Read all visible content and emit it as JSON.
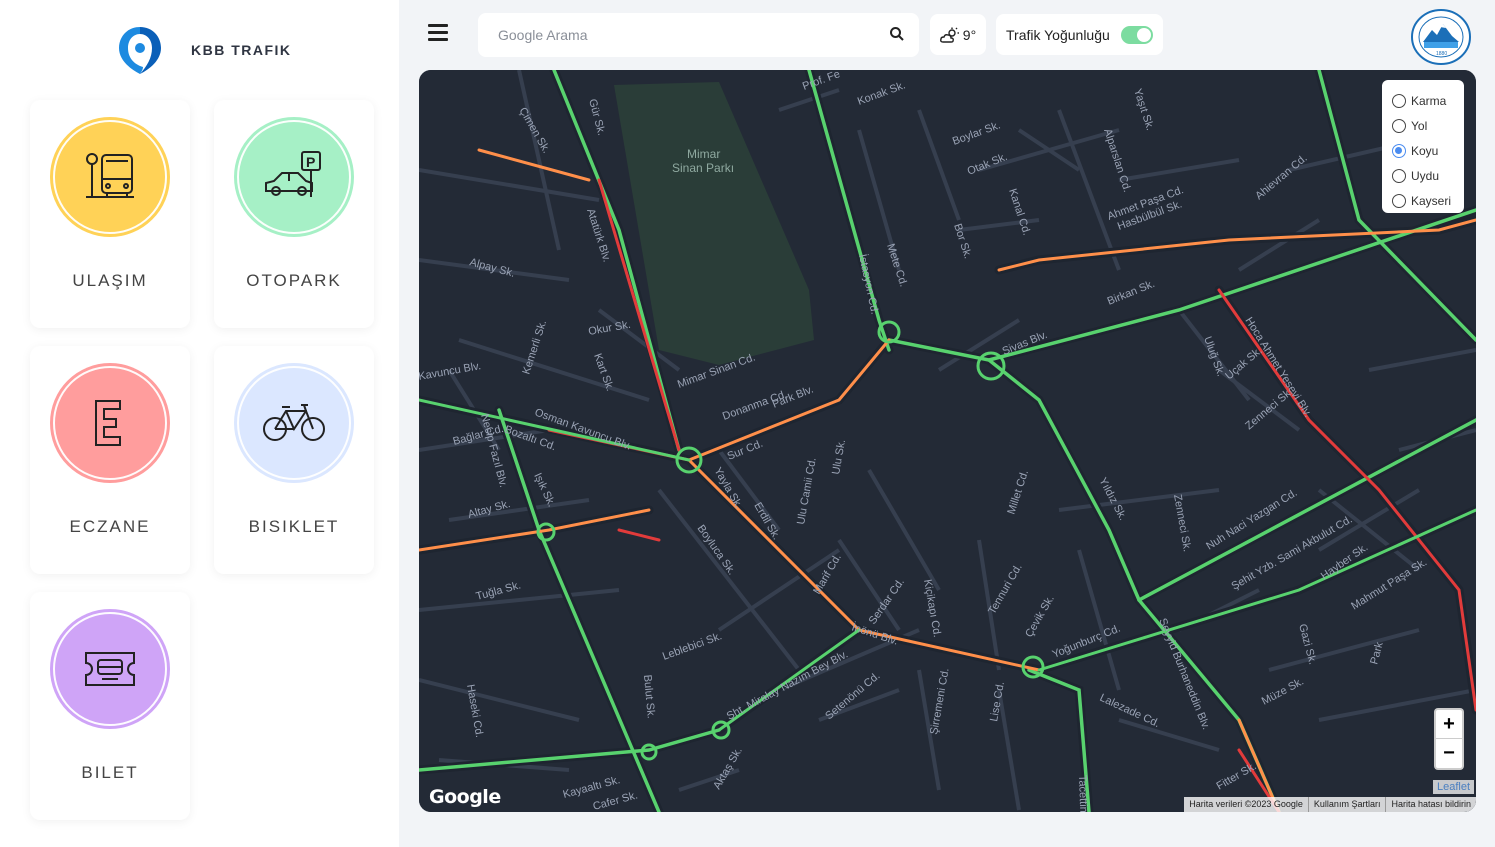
{
  "brand": {
    "name": "KBB TRAFIK",
    "logo": "kbb-trafik-logo"
  },
  "cards": [
    {
      "label": "ULAŞIM",
      "color": "#ffd257",
      "icon": "bus-stop-icon"
    },
    {
      "label": "OTOPARK",
      "color": "#a6f0c6",
      "icon": "parking-car-icon"
    },
    {
      "label": "ECZANE",
      "color": "#ff9d9d",
      "icon": "pharmacy-e-icon"
    },
    {
      "label": "BISIKLET",
      "color": "#dbe7ff",
      "icon": "bicycle-icon"
    },
    {
      "label": "BILET",
      "color": "#cfa4f7",
      "icon": "ticket-icon"
    }
  ],
  "header": {
    "menu_icon": "hamburger-menu-icon",
    "search_placeholder": "Google Arama",
    "search_icon": "search-icon",
    "weather_temp": "9°",
    "weather_icon": "partly-cloudy-sun-icon",
    "traffic_label": "Trafik Yoğunluğu",
    "traffic_toggle_on": true,
    "city_logo": "kayseri-buyuksehir-belediyesi-seal"
  },
  "map": {
    "layer_options": [
      "Karma",
      "Yol",
      "Koyu",
      "Uydu",
      "Kayseri"
    ],
    "selected_layer": "Koyu",
    "zoom_in": "+",
    "zoom_out": "−",
    "leaflet": "Leaflet",
    "google": "Google",
    "attribution": [
      "Harita verileri ©2023 Google",
      "Kullanım Şartları",
      "Harita hatası bildirin"
    ],
    "park_name": [
      "Mimar",
      "Sinan Parkı"
    ],
    "streets": [
      "Atatürk Blv.",
      "Gür Sk.",
      "Çimen Sk.",
      "Prof. Fe",
      "Konak Sk.",
      "Boylar Sk.",
      "Yaşıt Sk.",
      "İstasyon Cd.",
      "Otak Sk.",
      "Kanal Cd.",
      "Alparslan Cd.",
      "Ahmet Paşa Cd.",
      "Hasbülbül Sk.",
      "Ahievran Cd.",
      "Alpay Sk.",
      "Mete Cd.",
      "Bor Sk.",
      "Birkan Sk.",
      "Sivas Blv.",
      "Okur Sk.",
      "Kemerli Sk.",
      "Kart Sk.",
      "Mimar Sinan Cd.",
      "Donanma Cd.",
      "Park Blv.",
      "Hoca Ahmet Yesevi Blv.",
      "Uluğ Sk.",
      "Uçak Sk.",
      "Zenneci Sk.",
      "Kavuncu Blv.",
      "Osman Kavuncu Blv.",
      "Bağlar Cd.",
      "Bozaltı Cd.",
      "Necip Fazıl Blv.",
      "Sur Cd.",
      "Ulu Camii Cd.",
      "Ulu Sk.",
      "Yayla Sk.",
      "Erdil Sk.",
      "Millet Cd.",
      "Işık Sk.",
      "Altay Sk.",
      "Yıldız Sk.",
      "Zenneci Sk.",
      "Nuh Naci Yazgan Cd.",
      "Şehit Yzb. Sami Akbulut Cd.",
      "Hayber Sk.",
      "Tuğla Sk.",
      "Boyluca Sk.",
      "Marif Cd.",
      "Serdar Cd.",
      "Kiçikapı Cd.",
      "Tennuri Cd.",
      "Çevik Sk.",
      "Gazi Sk.",
      "Mahmut Paşa Sk.",
      "İnönü Blv.",
      "Yoğunburç Cd.",
      "Seyyid Burhaneddin Blv.",
      "Leblebici Sk.",
      "Bulut Sk.",
      "Şht. Miralay Nazım Bey Blv.",
      "Setenönü Cd.",
      "Şirremeni Cd.",
      "Lise Cd.",
      "Lalezade Cd.",
      "Müze Sk.",
      "Park",
      "Haseki Cd.",
      "Aktaş Sk.",
      "Kayaaltı Sk.",
      "Cafer Sk.",
      "Fitter Sk.",
      "Tacettin"
    ]
  }
}
